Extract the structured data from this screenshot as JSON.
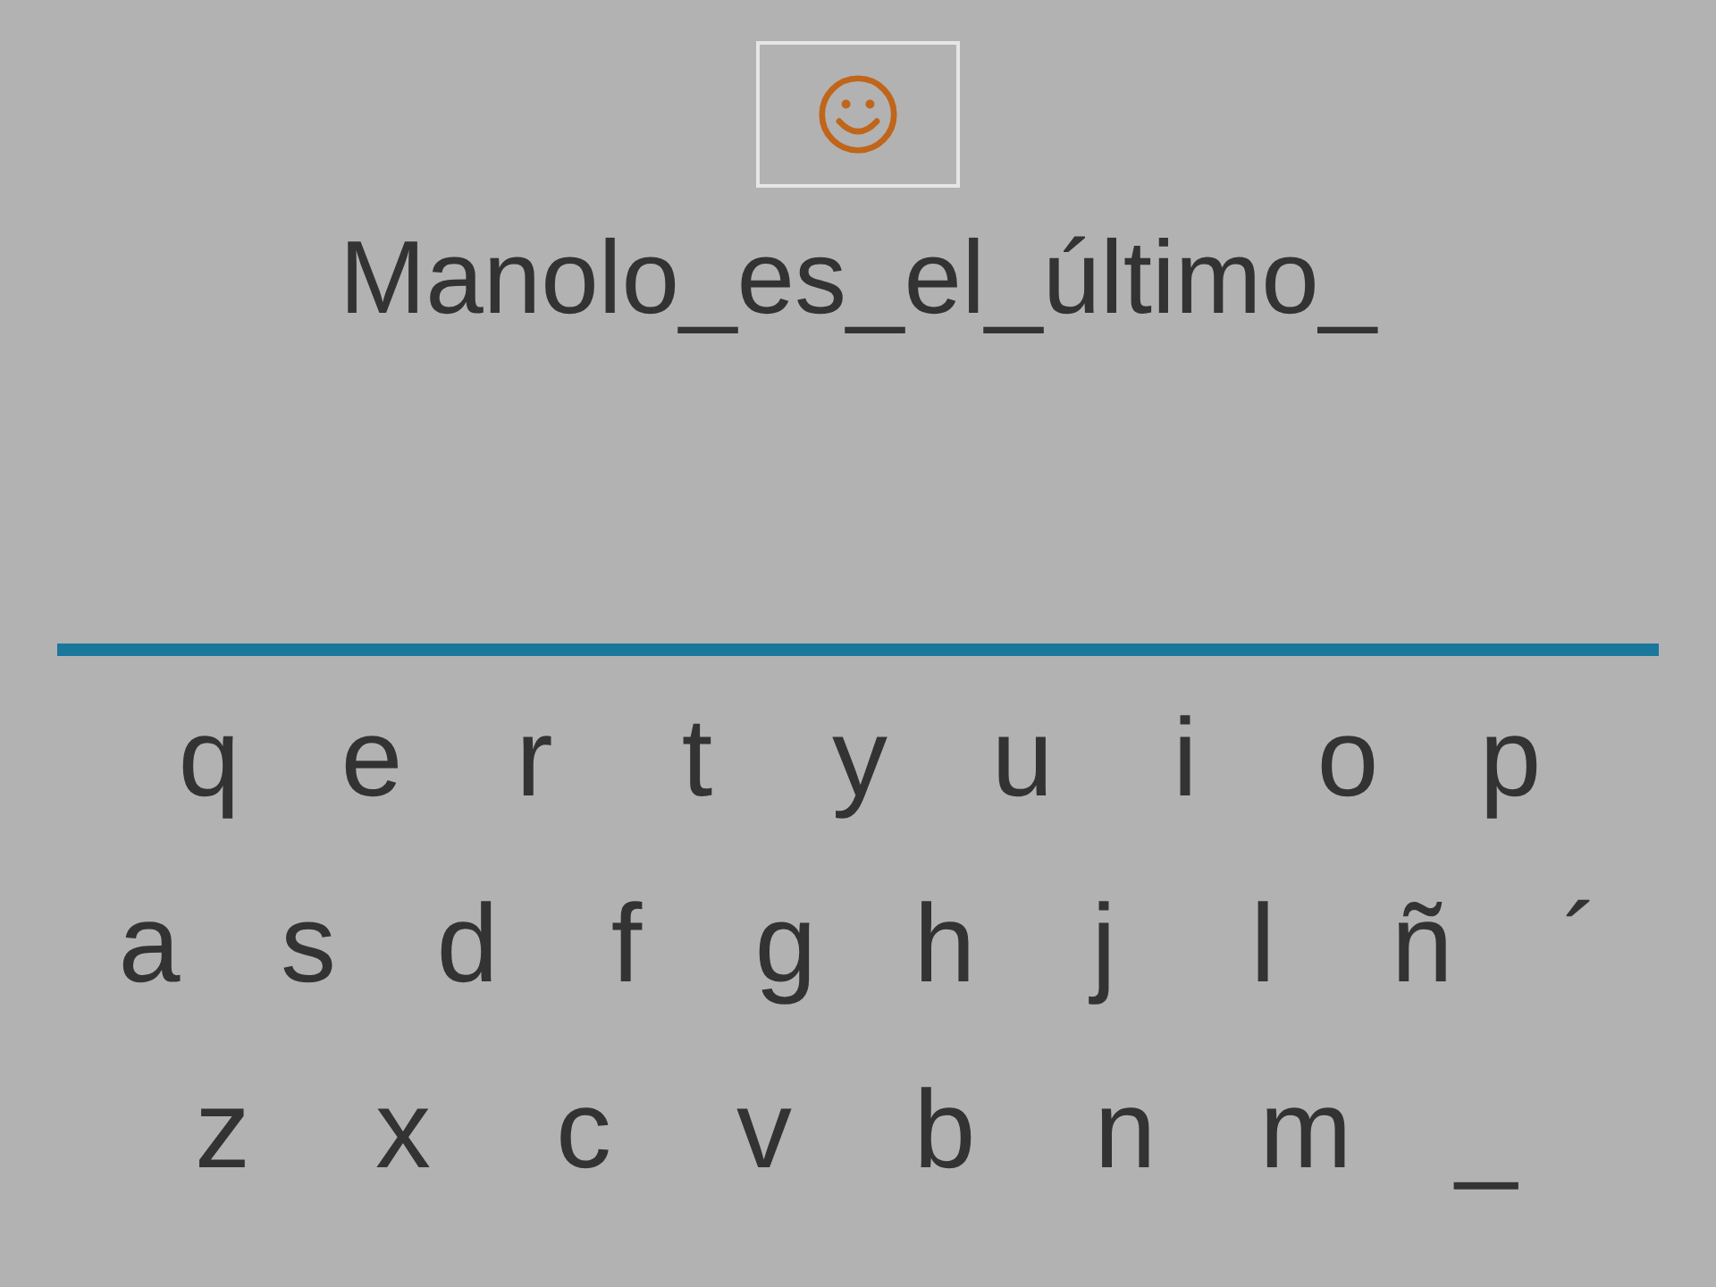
{
  "sentence": "Manolo_es_el_último_",
  "keyboard": {
    "rows": [
      [
        "q",
        "e",
        "r",
        "t",
        "y",
        "u",
        "i",
        "o",
        "p"
      ],
      [
        "a",
        "s",
        "d",
        "f",
        "g",
        "h",
        "j",
        "l",
        "ñ",
        "´"
      ],
      [
        "z",
        "x",
        "c",
        "v",
        "b",
        "n",
        "m",
        "_"
      ]
    ]
  }
}
